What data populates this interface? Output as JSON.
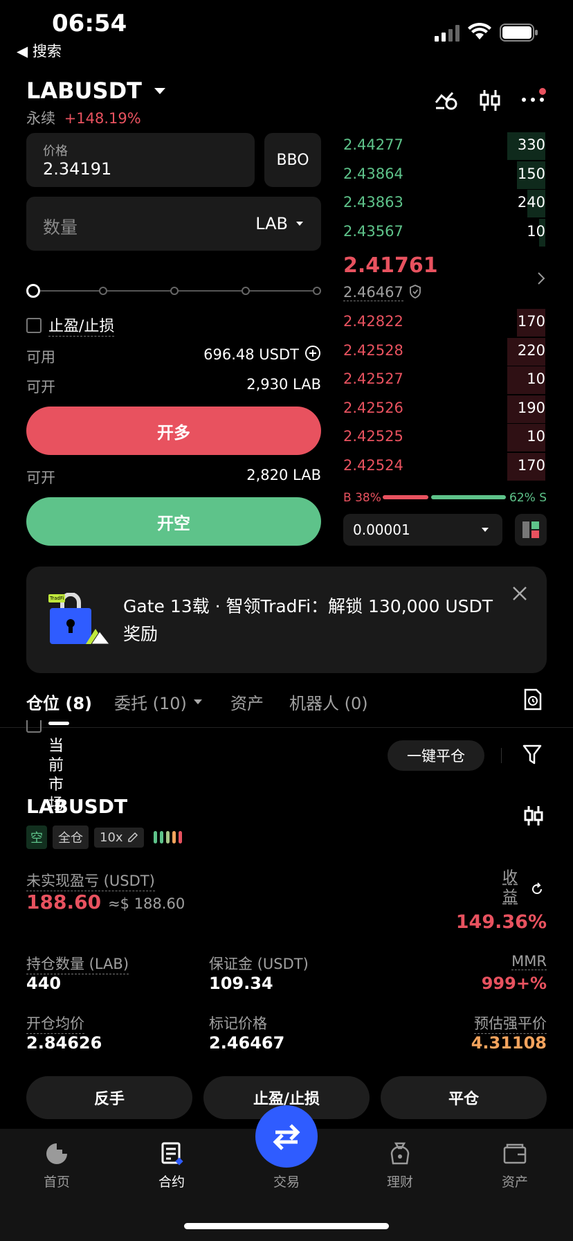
{
  "status_bar": {
    "time": "06:54",
    "back_label": "◀ 搜索"
  },
  "header": {
    "symbol": "LABUSDT",
    "type": "永续",
    "change": "+148.19%"
  },
  "order_form": {
    "price_label": "价格",
    "price_value": "2.34191",
    "bbo_label": "BBO",
    "qty_placeholder": "数量",
    "qty_unit": "LAB",
    "tpsl_label": "止盈/止损",
    "available_label": "可用",
    "available_value": "696.48 USDT",
    "open_label_1": "可开",
    "open_value_1": "2,930 LAB",
    "long_button": "开多",
    "open_label_2": "可开",
    "open_value_2": "2,820 LAB",
    "short_button": "开空"
  },
  "orderbook": {
    "asks": [
      {
        "price": "2.44277",
        "qty": "330",
        "depth": 0.19
      },
      {
        "price": "2.43864",
        "qty": "150",
        "depth": 0.14
      },
      {
        "price": "2.43863",
        "qty": "240",
        "depth": 0.09
      },
      {
        "price": "2.43567",
        "qty": "10",
        "depth": 0.03
      }
    ],
    "last_price": "2.41761",
    "mark_price": "2.46467",
    "bids": [
      {
        "price": "2.42822",
        "qty": "170",
        "depth": 0.14
      },
      {
        "price": "2.42528",
        "qty": "220",
        "depth": 0.19
      },
      {
        "price": "2.42527",
        "qty": "10",
        "depth": 0.19
      },
      {
        "price": "2.42526",
        "qty": "190",
        "depth": 0.19
      },
      {
        "price": "2.42525",
        "qty": "10",
        "depth": 0.19
      },
      {
        "price": "2.42524",
        "qty": "170",
        "depth": 0.19
      }
    ],
    "buy_ratio_label": "B 38%",
    "sell_ratio_label": "62% S",
    "buy_ratio": 0.38,
    "precision": "0.00001"
  },
  "banner": {
    "badge": "TradFi",
    "text": "Gate 13载 · 智领TradFi：解锁 130,000 USDT 奖励"
  },
  "tabs": {
    "positions": "仓位 (8)",
    "orders": "委托 (10)",
    "assets": "资产",
    "bots": "机器人 (0)"
  },
  "filter": {
    "current_market": "当前市场",
    "close_all": "一键平仓"
  },
  "position": {
    "symbol": "LABUSDT",
    "side": "空",
    "margin_mode": "全仓",
    "leverage": "10x",
    "upnl_label": "未实现盈亏 (USDT)",
    "upnl_value": "188.60",
    "upnl_usd": "≈$ 188.60",
    "roe_label": "收益",
    "roe_value": "149.36%",
    "size_label": "持仓数量 (LAB)",
    "size_value": "440",
    "margin_label": "保证金 (USDT)",
    "margin_value": "109.34",
    "mmr_label": "MMR",
    "mmr_value": "999+%",
    "entry_label": "开仓均价",
    "entry_value": "2.84626",
    "mark_label": "标记价格",
    "mark_value": "2.46467",
    "liq_label": "预估强平价",
    "liq_value": "4.31108",
    "btn_reverse": "反手",
    "btn_tpsl": "止盈/止损",
    "btn_close": "平仓"
  },
  "bottom_nav": {
    "home": "首页",
    "futures": "合约",
    "trade": "交易",
    "finance": "理财",
    "assets": "资产"
  },
  "colors": {
    "green": "#5ec38a",
    "red": "#e8525f",
    "orange": "#f3a35d",
    "accent_blue": "#2f5cff"
  }
}
